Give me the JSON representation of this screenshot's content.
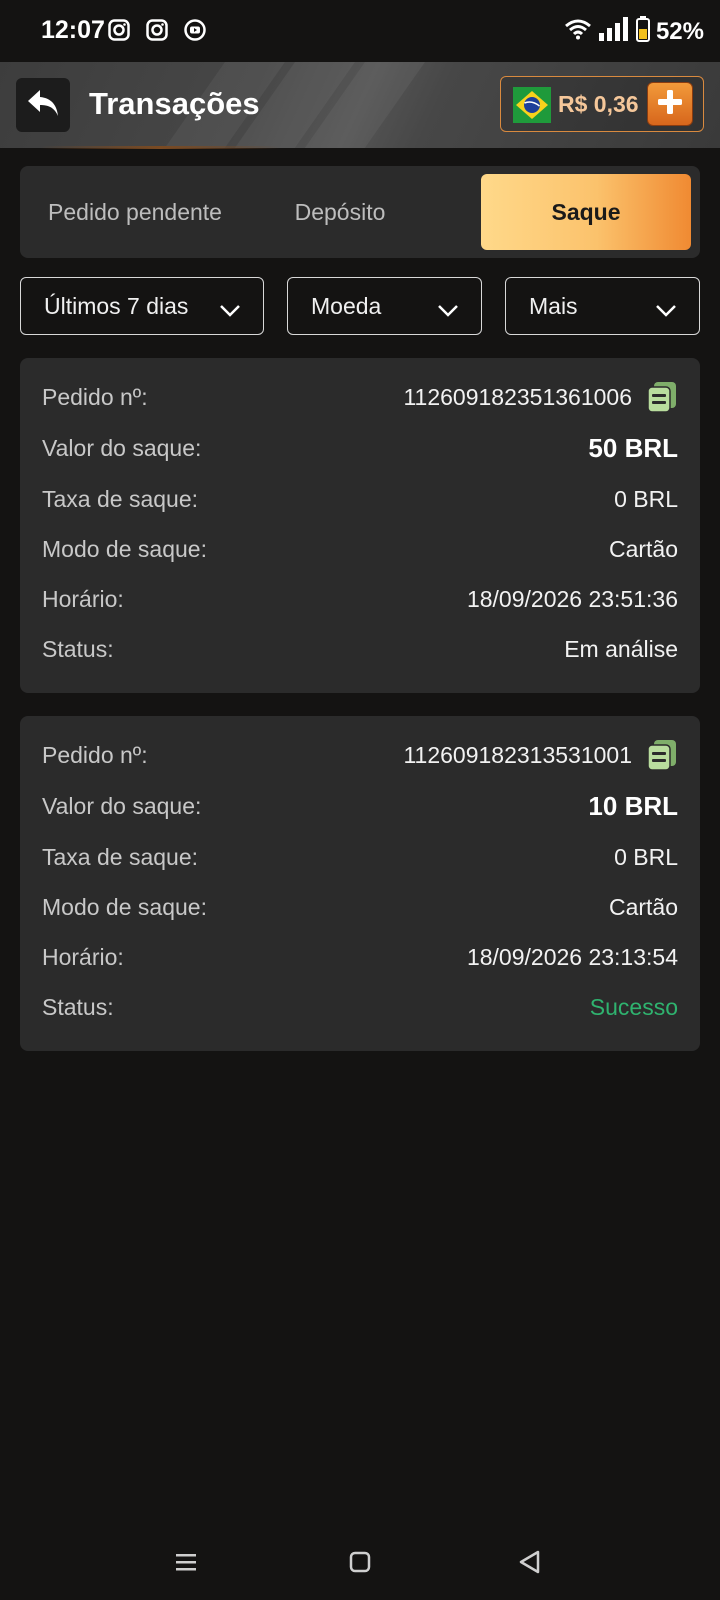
{
  "status_bar": {
    "time": "12:07",
    "battery": "52%",
    "icons": [
      "instagram-icon",
      "instagram-icon",
      "youtube-icon",
      "wifi-icon",
      "signal-icon",
      "battery-icon"
    ]
  },
  "header": {
    "title": "Transações",
    "balance": "R$ 0,36",
    "accent_color": "#e58a3a"
  },
  "tabs": [
    {
      "label": "Pedido pendente",
      "active": false
    },
    {
      "label": "Depósito",
      "active": false
    },
    {
      "label": "Saque",
      "active": true
    }
  ],
  "filters": [
    {
      "selected": "Últimos 7 dias"
    },
    {
      "selected": "Moeda"
    },
    {
      "selected": "Mais"
    }
  ],
  "labels": {
    "order": "Pedido nº:",
    "amount": "Valor do saque:",
    "fee": "Taxa de saque:",
    "mode": "Modo de saque:",
    "time": "Horário:",
    "status": "Status:"
  },
  "transactions": [
    {
      "order": "112609182351361006",
      "amount": "50 BRL",
      "fee": "0 BRL",
      "mode": "Cartão",
      "time": "18/09/2026 23:51:36",
      "status": "Em análise",
      "status_color": "#f2f2f2"
    },
    {
      "order": "112609182313531001",
      "amount": "10 BRL",
      "fee": "0 BRL",
      "mode": "Cartão",
      "time": "18/09/2026 23:13:54",
      "status": "Sucesso",
      "status_color": "#2fb36f"
    }
  ]
}
